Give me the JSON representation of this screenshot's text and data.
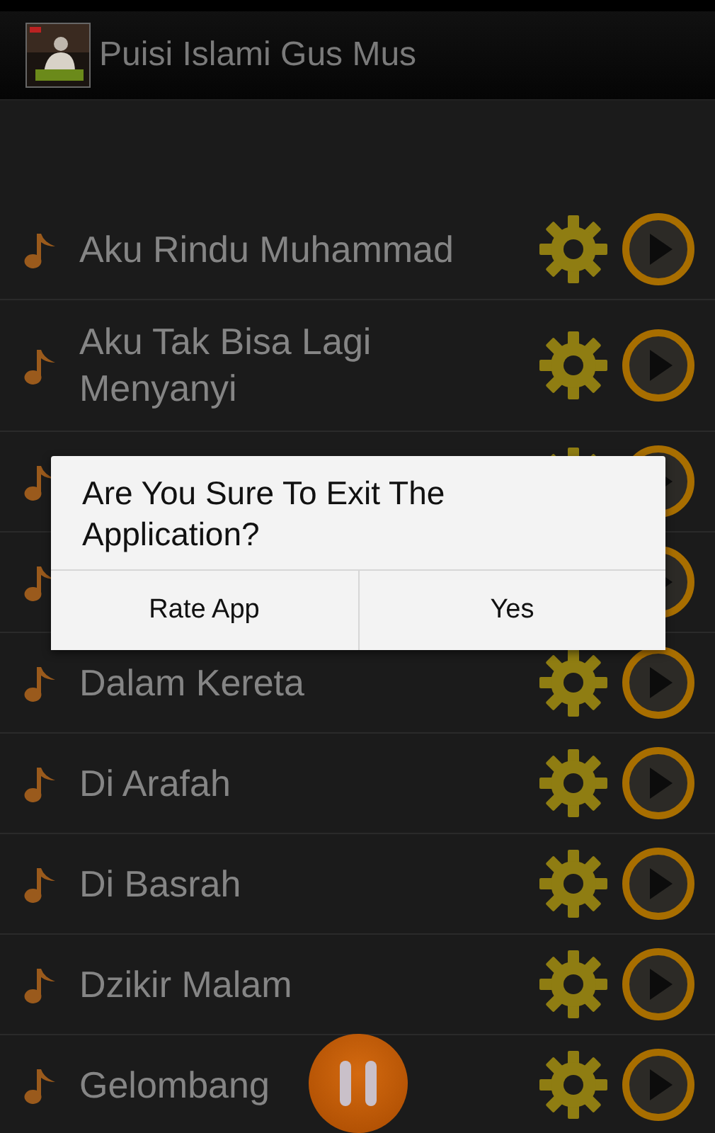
{
  "action_bar": {
    "title": "Puisi Islami Gus Mus"
  },
  "songs": [
    {
      "kind": "song",
      "title": "Aku Rindu Muhammad"
    },
    {
      "kind": "song",
      "title": "Aku Tak Bisa Lagi Menyanyi"
    },
    {
      "kind": "covered"
    },
    {
      "kind": "under_dialog"
    },
    {
      "kind": "song",
      "title": "Dalam Kereta"
    },
    {
      "kind": "song",
      "title": "Di Arafah"
    },
    {
      "kind": "song",
      "title": "Di Basrah"
    },
    {
      "kind": "song",
      "title": "Dzikir Malam"
    },
    {
      "kind": "song",
      "title": "Gelombang"
    }
  ],
  "dialog": {
    "message": "Are You Sure To Exit The Application?",
    "buttons": [
      "Rate App",
      "Yes"
    ]
  }
}
